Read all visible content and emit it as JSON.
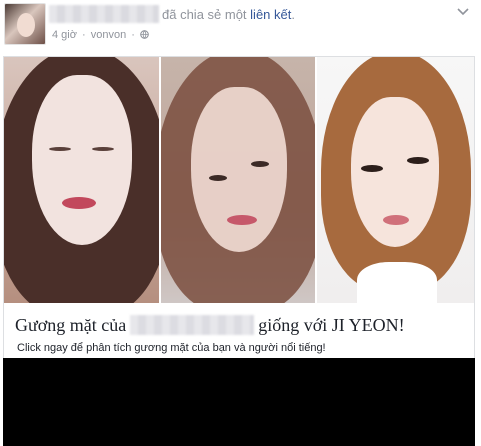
{
  "post": {
    "action_text": "đã chia sẻ một",
    "link_text": "liên kết",
    "punctuation": ".",
    "time": "4 giờ",
    "separator": "·",
    "source": "vonvon",
    "separator2": "·",
    "privacy_icon": "globe-icon",
    "menu_icon": "chevron-down-icon"
  },
  "card": {
    "title_prefix": "Gương mặt của",
    "title_suffix": "giống với JI YEON!",
    "description": "Click ngay để phân tích gương mặt của bạn và người nổi tiếng!"
  },
  "colors": {
    "link": "#365899",
    "muted": "#90949c",
    "text": "#1d2129"
  }
}
